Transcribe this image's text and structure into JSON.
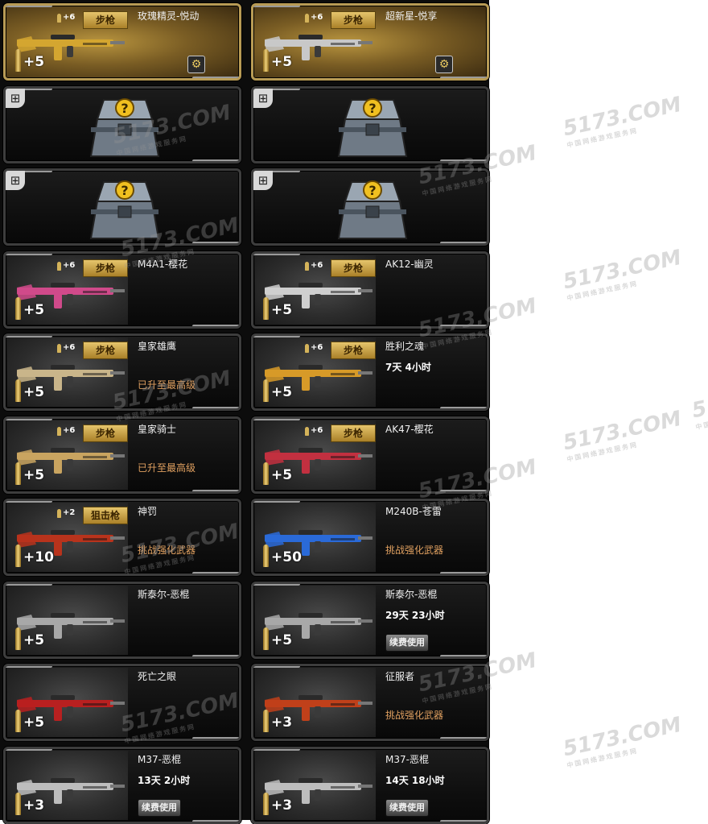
{
  "weapons": [
    {
      "name": "玫瑰精灵-悦动",
      "type": "步枪",
      "small": "+6",
      "level": "+5",
      "mod": true,
      "gold": true,
      "color": "#d4a630"
    },
    {
      "name": "超新星-悦享",
      "type": "步枪",
      "small": "+6",
      "level": "+5",
      "mod": true,
      "gold": true,
      "color": "#c8c8c8"
    },
    {
      "crate": true
    },
    {
      "crate": true
    },
    {
      "crate": true
    },
    {
      "crate": true
    },
    {
      "name": "M4A1-樱花",
      "type": "步枪",
      "small": "+6",
      "level": "+5",
      "color": "#d04a8a"
    },
    {
      "name": "AK12-幽灵",
      "type": "步枪",
      "small": "+6",
      "level": "+5",
      "color": "#cfcfcf"
    },
    {
      "name": "皇家雄鹰",
      "type": "步枪",
      "small": "+6",
      "level": "+5",
      "status": "已升至最高级",
      "color": "#c9b58a"
    },
    {
      "name": "胜利之魂",
      "type": "步枪",
      "small": "+6",
      "level": "+5",
      "sub": "7天 4小时",
      "color": "#d79a28"
    },
    {
      "name": "皇家骑士",
      "type": "步枪",
      "small": "+6",
      "level": "+5",
      "status": "已升至最高级",
      "color": "#c9a460"
    },
    {
      "name": "AK47-樱花",
      "type": "步枪",
      "small": "+6",
      "level": "+5",
      "color": "#c23040"
    },
    {
      "name": "神罚",
      "type": "狙击枪",
      "small": "+2",
      "level": "+10",
      "status": "挑战强化武器",
      "color": "#b8331c"
    },
    {
      "name": "M240B-苍雷",
      "level": "+50",
      "status": "挑战强化武器",
      "color": "#2a6ad8"
    },
    {
      "name": "斯泰尔-恶棍",
      "level": "+5",
      "color": "#a8a8a8"
    },
    {
      "name": "斯泰尔-恶棍",
      "level": "+5",
      "sub": "29天 23小时",
      "renew": "续费使用",
      "color": "#a8a8a8"
    },
    {
      "name": "死亡之眼",
      "level": "+5",
      "color": "#b82020"
    },
    {
      "name": "征服者",
      "level": "+3",
      "status": "挑战强化武器",
      "color": "#c0401a"
    },
    {
      "name": "M37-恶棍",
      "level": "+3",
      "sub": "13天 2小时",
      "renew": "续费使用",
      "color": "#bdbdbd"
    },
    {
      "name": "M37-恶棍",
      "level": "+3",
      "sub": "14天 18小时",
      "renew": "续费使用",
      "color": "#bdbdbd"
    }
  ],
  "icons": {
    "crate": "treasure-crate-icon",
    "gift": "gift-icon",
    "mod": "modify-icon"
  },
  "watermark": {
    "text": "5173.COM",
    "tagline": "中国网络游戏服务网"
  }
}
